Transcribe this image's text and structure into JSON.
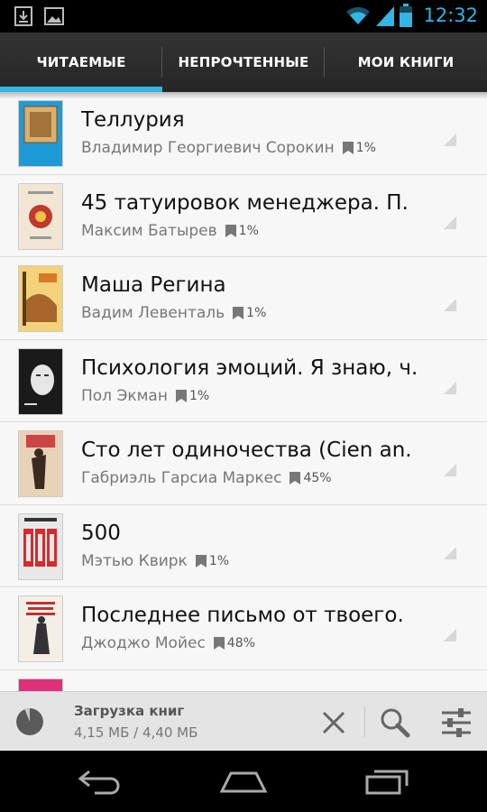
{
  "status_bar": {
    "time": "12:32",
    "icons": [
      "download-icon",
      "image-icon",
      "wifi-icon",
      "signal-icon",
      "battery-icon"
    ],
    "accent": "#33b5e5"
  },
  "tabs": [
    {
      "label": "ЧИТАЕМЫЕ",
      "selected": true
    },
    {
      "label": "НЕПРОЧТЕННЫЕ",
      "selected": false
    },
    {
      "label": "МОИ КНИГИ",
      "selected": false
    }
  ],
  "books": [
    {
      "title": "Теллурия",
      "author": "Владимир Георгиевич Сорокин",
      "progress": "1%",
      "cover_color": "#1e9bd7"
    },
    {
      "title": "45 татуировок менеджера. П.",
      "author": "Максим Батырев",
      "progress": "1%",
      "cover_color": "#f1e6d4"
    },
    {
      "title": "Маша Регина",
      "author": "Вадим Левенталь",
      "progress": "1%",
      "cover_color": "#f3d27a"
    },
    {
      "title": "Психология эмоций. Я знаю, ч.",
      "author": "Пол Экман",
      "progress": "1%",
      "cover_color": "#1a1a1a"
    },
    {
      "title": "Сто лет одиночества (Cien an.",
      "author": "Габриэль Гарсиа Маркес",
      "progress": "45%",
      "cover_color": "#e8d3b8"
    },
    {
      "title": "500",
      "author": "Мэтью Квирк",
      "progress": "1%",
      "cover_color": "#e8e8e8"
    },
    {
      "title": "Последнее письмо от твоего.",
      "author": "Джоджо Мойес",
      "progress": "48%",
      "cover_color": "#f4efe6"
    },
    {
      "title": "",
      "author": "",
      "progress": "",
      "cover_color": "#e0307a"
    }
  ],
  "download": {
    "title": "Загрузка книг",
    "size": "4,15 МБ / 4,40 МБ",
    "progress_fraction": 0.94
  },
  "actions": [
    "close-icon",
    "search-icon",
    "settings-sliders-icon"
  ],
  "nav": [
    "back-icon",
    "home-icon",
    "recent-apps-icon"
  ]
}
